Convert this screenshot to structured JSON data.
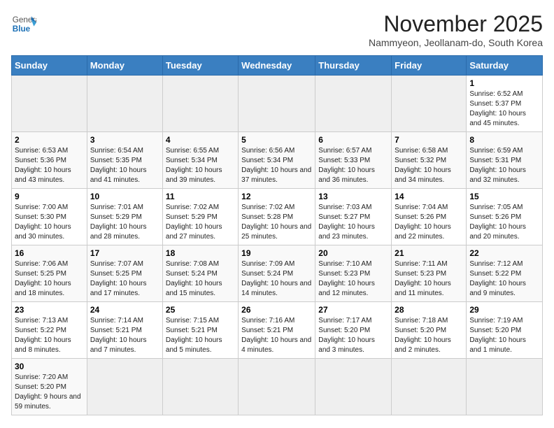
{
  "header": {
    "logo_general": "General",
    "logo_blue": "Blue",
    "title": "November 2025",
    "subtitle": "Nammyeon, Jeollanam-do, South Korea"
  },
  "weekdays": [
    "Sunday",
    "Monday",
    "Tuesday",
    "Wednesday",
    "Thursday",
    "Friday",
    "Saturday"
  ],
  "weeks": [
    [
      {
        "day": "",
        "empty": true
      },
      {
        "day": "",
        "empty": true
      },
      {
        "day": "",
        "empty": true
      },
      {
        "day": "",
        "empty": true
      },
      {
        "day": "",
        "empty": true
      },
      {
        "day": "",
        "empty": true
      },
      {
        "day": "1",
        "sunrise": "6:52 AM",
        "sunset": "5:37 PM",
        "daylight": "10 hours and 45 minutes."
      }
    ],
    [
      {
        "day": "2",
        "sunrise": "6:53 AM",
        "sunset": "5:36 PM",
        "daylight": "10 hours and 43 minutes."
      },
      {
        "day": "3",
        "sunrise": "6:54 AM",
        "sunset": "5:35 PM",
        "daylight": "10 hours and 41 minutes."
      },
      {
        "day": "4",
        "sunrise": "6:55 AM",
        "sunset": "5:34 PM",
        "daylight": "10 hours and 39 minutes."
      },
      {
        "day": "5",
        "sunrise": "6:56 AM",
        "sunset": "5:34 PM",
        "daylight": "10 hours and 37 minutes."
      },
      {
        "day": "6",
        "sunrise": "6:57 AM",
        "sunset": "5:33 PM",
        "daylight": "10 hours and 36 minutes."
      },
      {
        "day": "7",
        "sunrise": "6:58 AM",
        "sunset": "5:32 PM",
        "daylight": "10 hours and 34 minutes."
      },
      {
        "day": "8",
        "sunrise": "6:59 AM",
        "sunset": "5:31 PM",
        "daylight": "10 hours and 32 minutes."
      }
    ],
    [
      {
        "day": "9",
        "sunrise": "7:00 AM",
        "sunset": "5:30 PM",
        "daylight": "10 hours and 30 minutes."
      },
      {
        "day": "10",
        "sunrise": "7:01 AM",
        "sunset": "5:29 PM",
        "daylight": "10 hours and 28 minutes."
      },
      {
        "day": "11",
        "sunrise": "7:02 AM",
        "sunset": "5:29 PM",
        "daylight": "10 hours and 27 minutes."
      },
      {
        "day": "12",
        "sunrise": "7:02 AM",
        "sunset": "5:28 PM",
        "daylight": "10 hours and 25 minutes."
      },
      {
        "day": "13",
        "sunrise": "7:03 AM",
        "sunset": "5:27 PM",
        "daylight": "10 hours and 23 minutes."
      },
      {
        "day": "14",
        "sunrise": "7:04 AM",
        "sunset": "5:26 PM",
        "daylight": "10 hours and 22 minutes."
      },
      {
        "day": "15",
        "sunrise": "7:05 AM",
        "sunset": "5:26 PM",
        "daylight": "10 hours and 20 minutes."
      }
    ],
    [
      {
        "day": "16",
        "sunrise": "7:06 AM",
        "sunset": "5:25 PM",
        "daylight": "10 hours and 18 minutes."
      },
      {
        "day": "17",
        "sunrise": "7:07 AM",
        "sunset": "5:25 PM",
        "daylight": "10 hours and 17 minutes."
      },
      {
        "day": "18",
        "sunrise": "7:08 AM",
        "sunset": "5:24 PM",
        "daylight": "10 hours and 15 minutes."
      },
      {
        "day": "19",
        "sunrise": "7:09 AM",
        "sunset": "5:24 PM",
        "daylight": "10 hours and 14 minutes."
      },
      {
        "day": "20",
        "sunrise": "7:10 AM",
        "sunset": "5:23 PM",
        "daylight": "10 hours and 12 minutes."
      },
      {
        "day": "21",
        "sunrise": "7:11 AM",
        "sunset": "5:23 PM",
        "daylight": "10 hours and 11 minutes."
      },
      {
        "day": "22",
        "sunrise": "7:12 AM",
        "sunset": "5:22 PM",
        "daylight": "10 hours and 9 minutes."
      }
    ],
    [
      {
        "day": "23",
        "sunrise": "7:13 AM",
        "sunset": "5:22 PM",
        "daylight": "10 hours and 8 minutes."
      },
      {
        "day": "24",
        "sunrise": "7:14 AM",
        "sunset": "5:21 PM",
        "daylight": "10 hours and 7 minutes."
      },
      {
        "day": "25",
        "sunrise": "7:15 AM",
        "sunset": "5:21 PM",
        "daylight": "10 hours and 5 minutes."
      },
      {
        "day": "26",
        "sunrise": "7:16 AM",
        "sunset": "5:21 PM",
        "daylight": "10 hours and 4 minutes."
      },
      {
        "day": "27",
        "sunrise": "7:17 AM",
        "sunset": "5:20 PM",
        "daylight": "10 hours and 3 minutes."
      },
      {
        "day": "28",
        "sunrise": "7:18 AM",
        "sunset": "5:20 PM",
        "daylight": "10 hours and 2 minutes."
      },
      {
        "day": "29",
        "sunrise": "7:19 AM",
        "sunset": "5:20 PM",
        "daylight": "10 hours and 1 minute."
      }
    ],
    [
      {
        "day": "30",
        "sunrise": "7:20 AM",
        "sunset": "5:20 PM",
        "daylight": "9 hours and 59 minutes."
      },
      {
        "day": "",
        "empty": true
      },
      {
        "day": "",
        "empty": true
      },
      {
        "day": "",
        "empty": true
      },
      {
        "day": "",
        "empty": true
      },
      {
        "day": "",
        "empty": true
      },
      {
        "day": "",
        "empty": true
      }
    ]
  ]
}
